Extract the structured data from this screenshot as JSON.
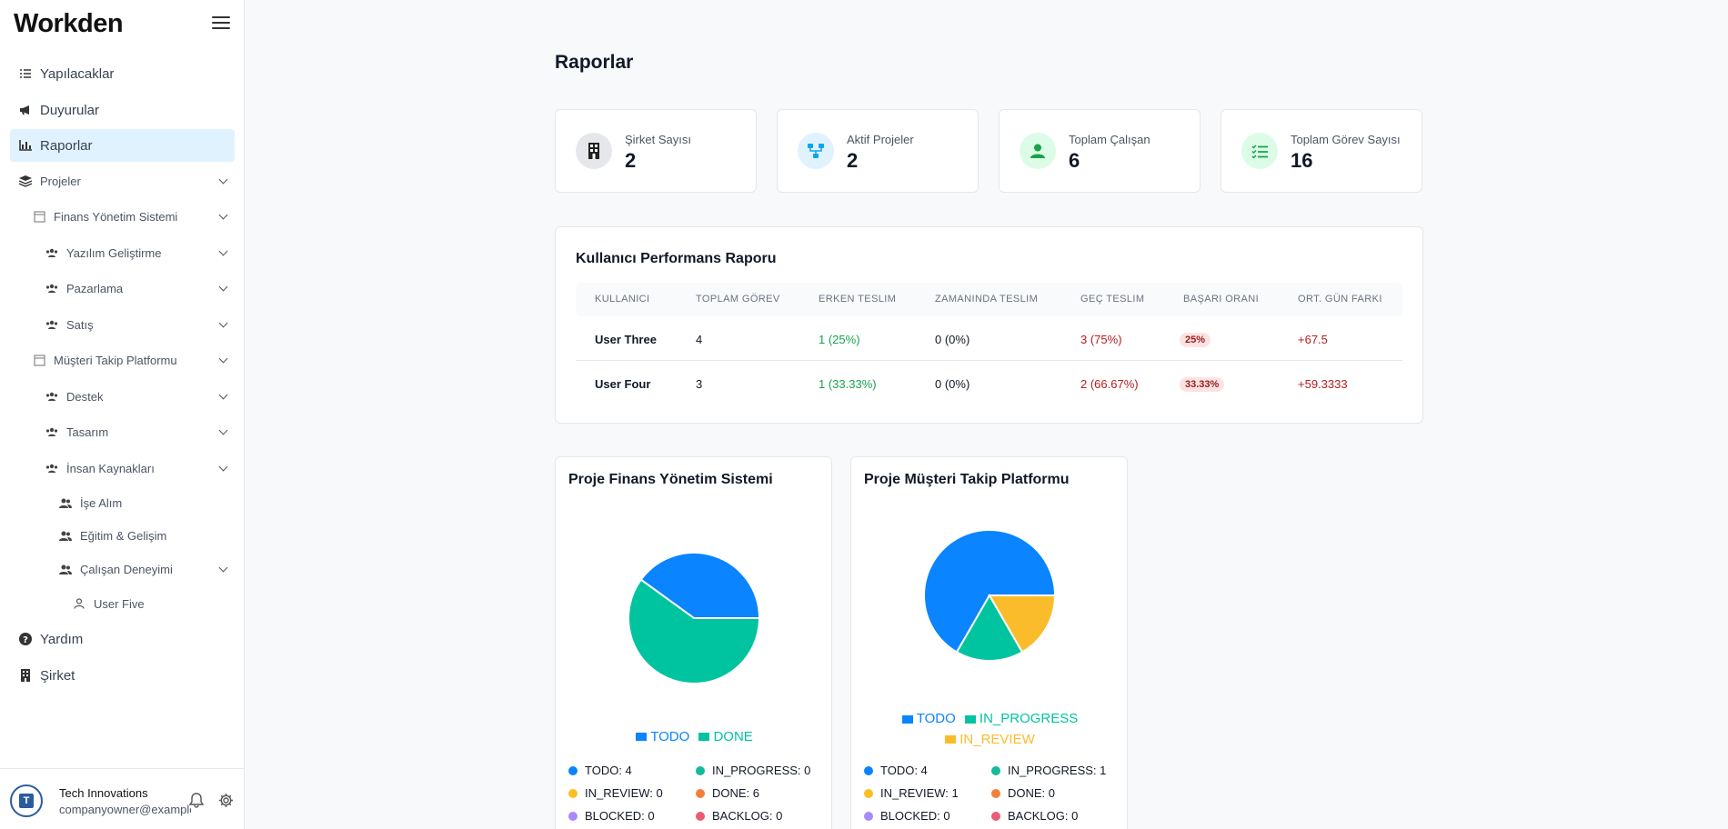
{
  "brand": "Workden",
  "sidebar": {
    "items": [
      {
        "label": "Yapılacaklar",
        "icon": "list-check-icon"
      },
      {
        "label": "Duyurular",
        "icon": "megaphone-icon"
      },
      {
        "label": "Raporlar",
        "icon": "chart-bar-icon",
        "active": true
      },
      {
        "label": "Projeler",
        "icon": "layers-icon"
      },
      {
        "label": "Finans Yönetim Sistemi",
        "icon": "project-icon"
      },
      {
        "label": "Yazılım Geliştirme",
        "icon": "team-icon"
      },
      {
        "label": "Pazarlama",
        "icon": "team-icon"
      },
      {
        "label": "Satış",
        "icon": "team-icon"
      },
      {
        "label": "Müşteri Takip Platformu",
        "icon": "project-icon"
      },
      {
        "label": "Destek",
        "icon": "team-icon"
      },
      {
        "label": "Tasarım",
        "icon": "team-icon"
      },
      {
        "label": "İnsan Kaynakları",
        "icon": "team-icon"
      },
      {
        "label": "İşe Alım",
        "icon": "users-icon"
      },
      {
        "label": "Eğitim & Gelişim",
        "icon": "users-icon"
      },
      {
        "label": "Çalışan Deneyimi",
        "icon": "users-icon"
      },
      {
        "label": "User Five",
        "icon": "user-icon"
      },
      {
        "label": "Yardım",
        "icon": "help-icon"
      },
      {
        "label": "Şirket",
        "icon": "building-icon"
      }
    ],
    "footer": {
      "org": "Tech Innovations",
      "email": "companyowner@example.com"
    }
  },
  "main": {
    "title": "Raporlar",
    "stats": [
      {
        "label": "Şirket Sayısı",
        "value": "2",
        "icon": "building-icon",
        "color": "#e5e7eb"
      },
      {
        "label": "Aktif Projeler",
        "value": "2",
        "icon": "network-icon",
        "color": "#e0f2fe"
      },
      {
        "label": "Toplam Çalışan",
        "value": "6",
        "icon": "user-icon",
        "color": "#dcfce7"
      },
      {
        "label": "Toplam Görev Sayısı",
        "value": "16",
        "icon": "list-icon",
        "color": "#dcfce7"
      }
    ],
    "report": {
      "title": "Kullanıcı Performans Raporu",
      "headers": [
        "KULLANICI",
        "TOPLAM GÖREV",
        "ERKEN TESLIM",
        "ZAMANINDA TESLIM",
        "GEÇ TESLIM",
        "BAŞARI ORANI",
        "ORT. GÜN FARKI"
      ],
      "rows": [
        {
          "user": "User Three",
          "total": "4",
          "early": "1 (25%)",
          "ontime": "0 (0%)",
          "late": "3 (75%)",
          "rate": "25%",
          "diff": "+67.5"
        },
        {
          "user": "User Four",
          "total": "3",
          "early": "1 (33.33%)",
          "ontime": "0 (0%)",
          "late": "2 (66.67%)",
          "rate": "33.33%",
          "diff": "+59.3333"
        }
      ]
    },
    "projects": [
      {
        "title": "Proje Finans Yönetim Sistemi",
        "legend": [
          "TODO",
          "DONE"
        ],
        "statuses": [
          {
            "label": "TODO: 4",
            "color": "#0a84ff"
          },
          {
            "label": "IN_PROGRESS: 0",
            "color": "#14b89a"
          },
          {
            "label": "IN_REVIEW: 0",
            "color": "#fbbf24"
          },
          {
            "label": "DONE: 6",
            "color": "#f2803c"
          },
          {
            "label": "BLOCKED: 0",
            "color": "#a78bfa"
          },
          {
            "label": "BACKLOG: 0",
            "color": "#e85d75"
          }
        ]
      },
      {
        "title": "Proje Müşteri Takip Platformu",
        "legend": [
          "TODO",
          "IN_PROGRESS",
          "IN_REVIEW"
        ],
        "statuses": [
          {
            "label": "TODO: 4",
            "color": "#0a84ff"
          },
          {
            "label": "IN_PROGRESS: 1",
            "color": "#14b89a"
          },
          {
            "label": "IN_REVIEW: 1",
            "color": "#fbbf24"
          },
          {
            "label": "DONE: 0",
            "color": "#f2803c"
          },
          {
            "label": "BLOCKED: 0",
            "color": "#a78bfa"
          },
          {
            "label": "BACKLOG: 0",
            "color": "#e85d75"
          }
        ]
      }
    ]
  },
  "chart_data": [
    {
      "type": "pie",
      "title": "Proje Finans Yönetim Sistemi",
      "categories": [
        "TODO",
        "DONE"
      ],
      "values": [
        4,
        6
      ],
      "colors": [
        "#0a84ff",
        "#00c49f"
      ]
    },
    {
      "type": "pie",
      "title": "Proje Müşteri Takip Platformu",
      "categories": [
        "TODO",
        "IN_PROGRESS",
        "IN_REVIEW"
      ],
      "values": [
        4,
        1,
        1
      ],
      "colors": [
        "#0a84ff",
        "#00c49f",
        "#fbbc2c"
      ]
    }
  ]
}
